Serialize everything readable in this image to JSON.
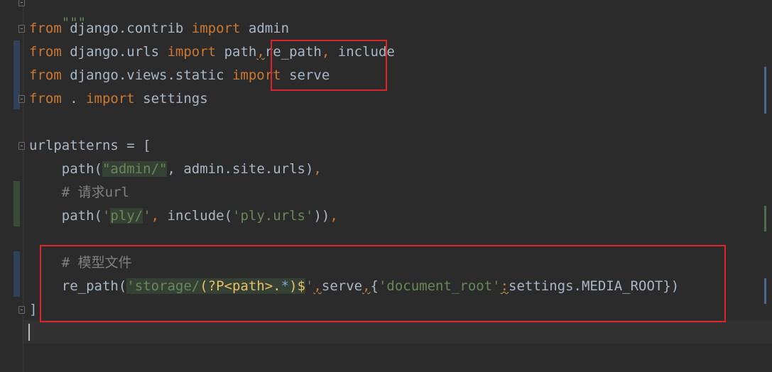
{
  "editor": {
    "lines": {
      "l0": {
        "text": "\"\"\""
      },
      "l1": {
        "from": "from",
        "mod": " django.contrib ",
        "imp": "import",
        "name": " admin"
      },
      "l2": {
        "from": "from",
        "mod": " django.urls ",
        "imp": "import",
        "name1": " path",
        "comma1": ",",
        "name2": "re_path",
        "comma2": ",",
        "name3": " include"
      },
      "l3": {
        "from": "from",
        "mod": " django.views.static ",
        "imp": "import",
        "name": " serve"
      },
      "l4": {
        "from": "from",
        "mod": " . ",
        "imp": "import",
        "name": " settings"
      },
      "l6": {
        "text": "urlpatterns = ["
      },
      "l7": {
        "indent": "    ",
        "fn": "path(",
        "str": "\"admin/\"",
        "rest": ", admin.site.urls)",
        "comma": ","
      },
      "l8": {
        "indent": "    ",
        "comment": "# 请求url"
      },
      "l9": {
        "indent": "    ",
        "fn": "path(",
        "q1": "'",
        "str": "ply/",
        "q2": "'",
        "sep": ", ",
        "fn2": "include(",
        "str2": "'ply.urls'",
        "rest": "))",
        "comma": ","
      },
      "l11": {
        "indent": "    ",
        "comment": "# 模型文件"
      },
      "l12": {
        "indent": "    ",
        "fn": "re_path(",
        "s1": "'storage/",
        "r1": "(?P<path>.",
        "r2": "*",
        "r3": ")$",
        "s2": "'",
        "c1": ",",
        "serve": "serve",
        "c2": ",",
        "brace": "{",
        "s3": "'document_root'",
        "colon": ":",
        "rest": "settings.MEDIA_ROOT})"
      },
      "l13": {
        "text": "]"
      }
    }
  }
}
